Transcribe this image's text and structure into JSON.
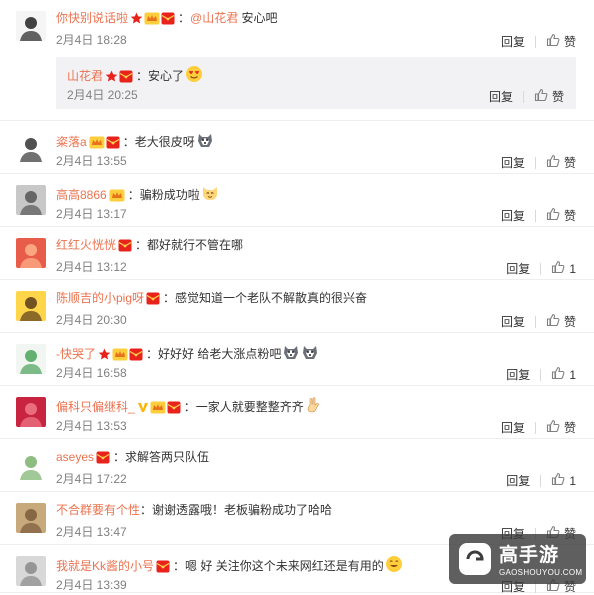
{
  "colors": {
    "username": "#eb7350",
    "meta": "#808080",
    "text": "#333333",
    "reply_bg": "#f2f2f5"
  },
  "actions": {
    "reply_label": "回复",
    "like_label": "赞"
  },
  "comments": [
    {
      "username": "你快别说话啦",
      "badges": [
        "star-badge",
        "vip-crown-badge",
        "red-packet-badge"
      ],
      "mention": "@山花君",
      "text": " 安心吧",
      "time": "2月4日 18:28",
      "likes": "",
      "emoji": [],
      "reply": {
        "username": "山花君",
        "badges": [
          "star-badge",
          "red-packet-badge"
        ],
        "text": "安心了",
        "emoji": [
          "heart-eyes-emoji"
        ],
        "time": "2月4日 20:25",
        "likes": ""
      }
    },
    {
      "username": "粢落a",
      "badges": [
        "vip-crown-badge",
        "red-packet-badge"
      ],
      "text": "老大很皮呀",
      "time": "2月4日 13:55",
      "likes": "",
      "emoji": [
        "husky-emoji"
      ]
    },
    {
      "username": "高高8866",
      "badges": [
        "vip-crown-badge"
      ],
      "text": "骗粉成功啦",
      "time": "2月4日 13:17",
      "likes": "",
      "emoji": [
        "cat-emoji"
      ]
    },
    {
      "username": "红红火恍恍",
      "badges": [
        "red-packet-badge"
      ],
      "text": "都好就行不管在哪",
      "time": "2月4日 13:12",
      "likes": "1",
      "emoji": []
    },
    {
      "username": "陈顺吉的小pig呀",
      "badges": [
        "red-packet-badge"
      ],
      "text": "感觉知道一个老队不解散真的很兴奋",
      "time": "2月4日 20:30",
      "likes": "",
      "emoji": []
    },
    {
      "username": "-快哭了",
      "badges": [
        "star-badge",
        "vip-crown-badge",
        "red-packet-badge"
      ],
      "text": "好好好 给老大涨点粉吧",
      "time": "2月4日 16:58",
      "likes": "1",
      "emoji": [
        "husky-emoji",
        "husky-emoji"
      ]
    },
    {
      "username": "偏科只偏继科_",
      "badges": [
        "v-badge",
        "vip-crown-badge",
        "red-packet-badge"
      ],
      "text": "一家人就要整整齐齐",
      "time": "2月4日 13:53",
      "likes": "",
      "emoji": [
        "victory-hand-emoji"
      ]
    },
    {
      "username": "aseyes",
      "badges": [
        "red-packet-badge"
      ],
      "text": "求解答两只队伍",
      "time": "2月4日 17:22",
      "likes": "1",
      "emoji": []
    },
    {
      "username": "不合群要有个性",
      "badges": [],
      "text": "谢谢透露哦！老板骗粉成功了哈哈",
      "time": "2月4日 13:47",
      "likes": "",
      "emoji": []
    },
    {
      "username": "我就是Kk酱的小号",
      "badges": [
        "red-packet-badge"
      ],
      "text": "嗯 好 关注你这个未来网红还是有用的",
      "time": "2月4日 13:39",
      "likes": "",
      "emoji": [
        "smile-emoji"
      ]
    }
  ],
  "watermark": {
    "title": "高手游",
    "url": "GAOSHOUYOU.COM"
  }
}
